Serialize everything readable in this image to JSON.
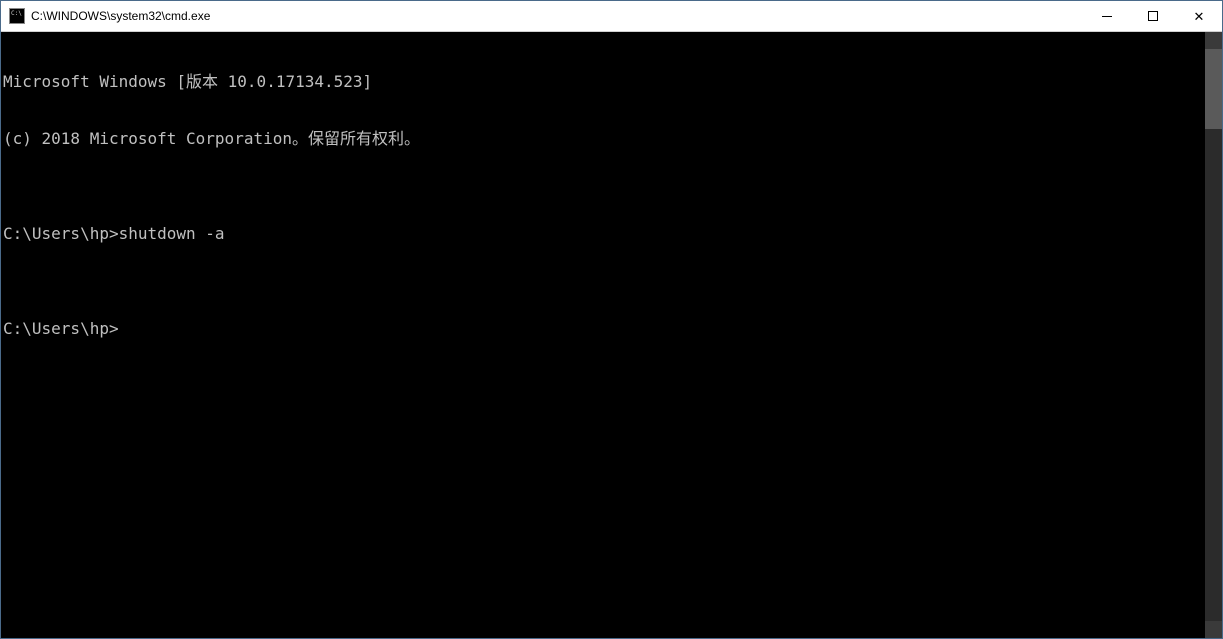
{
  "window": {
    "title": "C:\\WINDOWS\\system32\\cmd.exe"
  },
  "terminal": {
    "lines": [
      "Microsoft Windows [版本 10.0.17134.523]",
      "(c) 2018 Microsoft Corporation。保留所有权利。",
      "",
      "C:\\Users\\hp>shutdown -a",
      "",
      "C:\\Users\\hp>"
    ]
  }
}
